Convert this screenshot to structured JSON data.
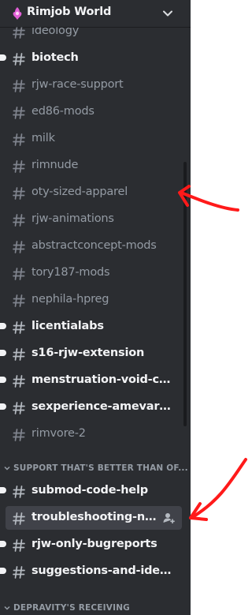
{
  "server": {
    "name": "Rimjob World"
  },
  "channels_top": [
    {
      "label": "ideology",
      "state": "read"
    },
    {
      "label": "biotech",
      "state": "unread"
    },
    {
      "label": "rjw-race-support",
      "state": "read"
    },
    {
      "label": "ed86-mods",
      "state": "read"
    },
    {
      "label": "milk",
      "state": "read"
    },
    {
      "label": "rimnude",
      "state": "read"
    },
    {
      "label": "oty-sized-apparel",
      "state": "read"
    },
    {
      "label": "rjw-animations",
      "state": "read"
    },
    {
      "label": "abstractconcept-mods",
      "state": "read"
    },
    {
      "label": "tory187-mods",
      "state": "read"
    },
    {
      "label": "nephila-hpreg",
      "state": "read"
    },
    {
      "label": "licentialabs",
      "state": "unread"
    },
    {
      "label": "s16-rjw-extension",
      "state": "unread"
    },
    {
      "label": "menstruation-void-chic...",
      "state": "unread"
    },
    {
      "label": "sexperience-amevarashi",
      "state": "unread"
    },
    {
      "label": "rimvore-2",
      "state": "read"
    }
  ],
  "category_support": {
    "label": "SUPPORT THAT'S BETTER THAN OF..."
  },
  "channels_support": [
    {
      "label": "submod-code-help",
      "state": "unread"
    },
    {
      "label": "troubleshooting-n-help",
      "state": "selected"
    },
    {
      "label": "rjw-only-bugreports",
      "state": "unread"
    },
    {
      "label": "suggestions-and-ideas",
      "state": "unread"
    }
  ],
  "category_depravity": {
    "label": "DEPRAVITY'S RECEIVING"
  },
  "colors": {
    "sidebar_bg": "#2b2d31",
    "text_unread": "#f2f3f5",
    "text_read": "#949ba4",
    "selected_bg": "#404249",
    "annotation_red": "#ff1a1a",
    "server_icon_pink": "#e15fd6"
  },
  "icons": {
    "server": "server-avatar-icon",
    "chevron": "chevron-down-icon",
    "channel": "hashtag-icon",
    "invite": "add-member-icon"
  }
}
